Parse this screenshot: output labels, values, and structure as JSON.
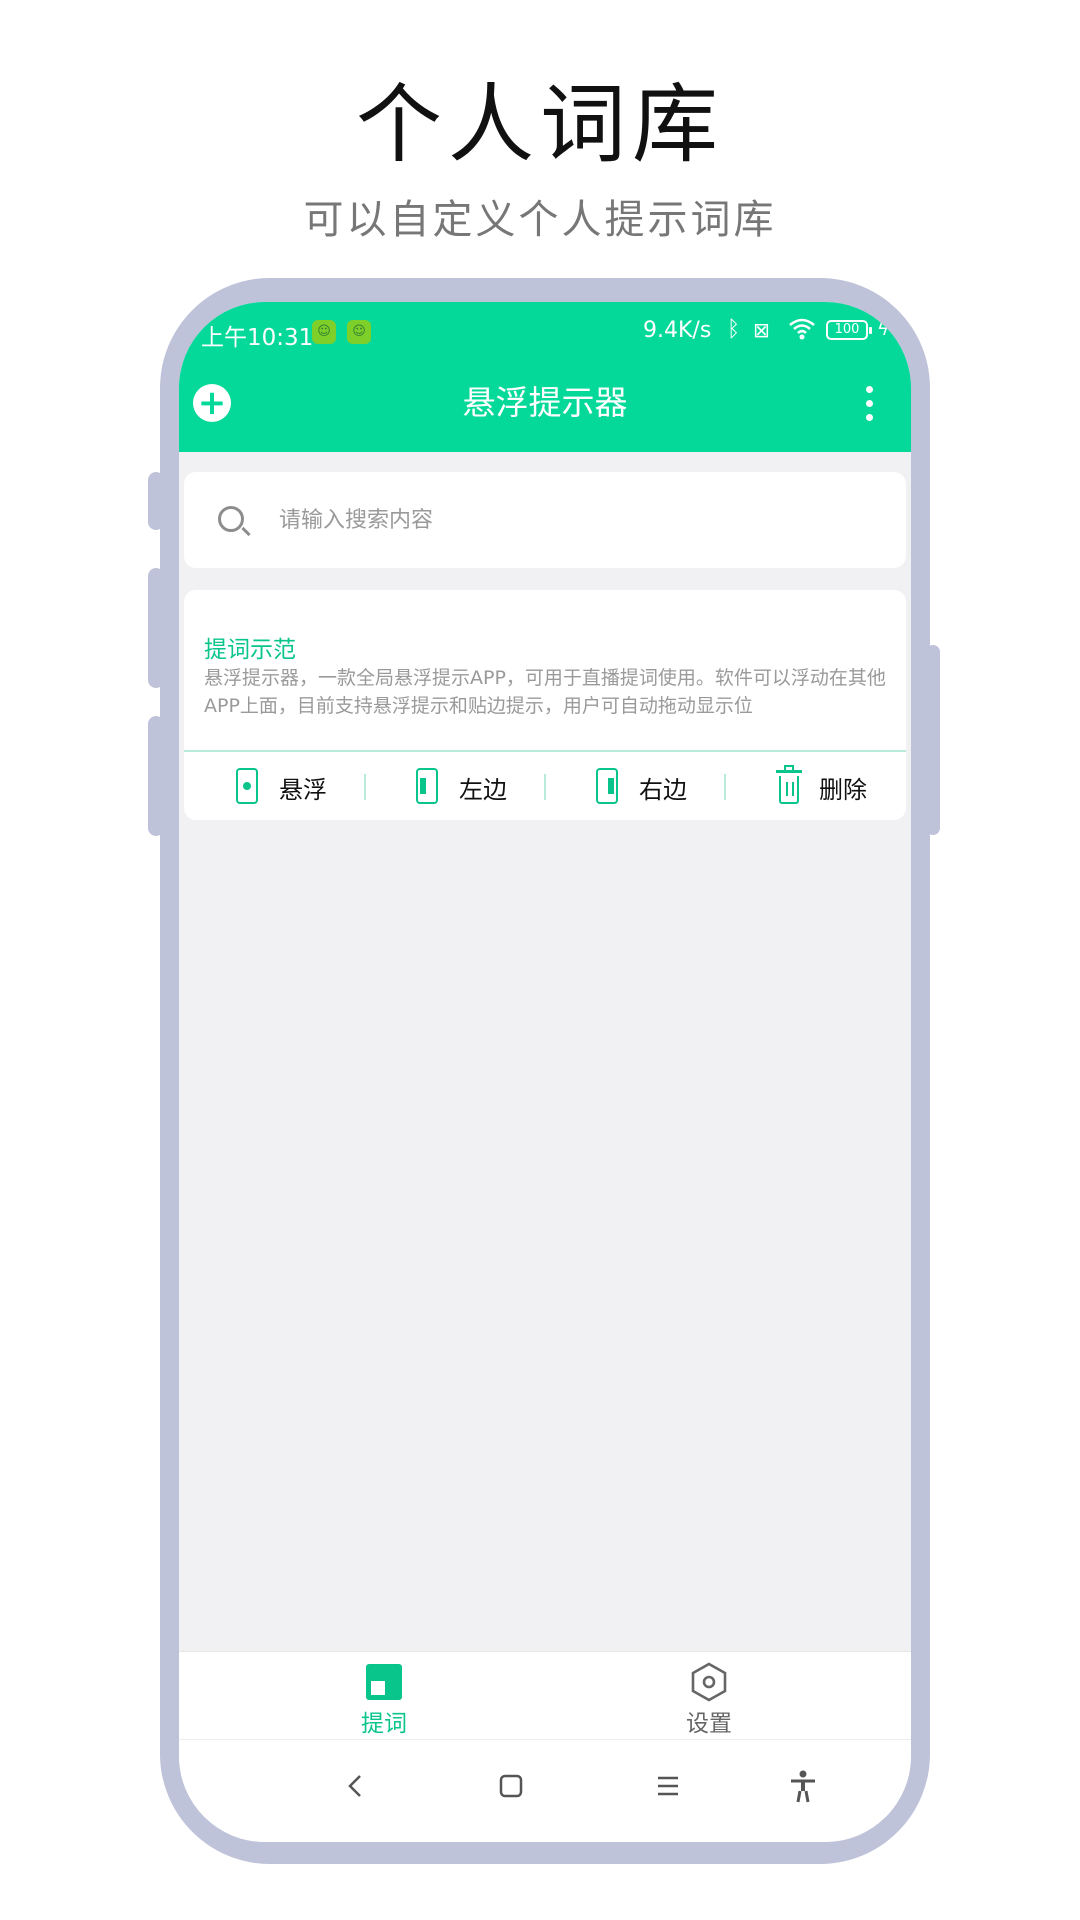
{
  "promo": {
    "title": "个人词库",
    "subtitle": "可以自定义个人提示词库"
  },
  "status_bar": {
    "time": "上午10:31",
    "network_speed": "9.4K/s",
    "battery": "100"
  },
  "header": {
    "title": "悬浮提示器",
    "add_icon": "plus-circle-icon",
    "more_icon": "more-vertical-icon"
  },
  "search": {
    "placeholder": "请输入搜索内容",
    "value": "",
    "icon": "search-icon"
  },
  "card": {
    "title": "提词示范",
    "description": "悬浮提示器，一款全局悬浮提示APP，可用于直播提词使用。软件可以浮动在其他APP上面，目前支持悬浮提示和贴边提示，用户可自动拖动显示位",
    "actions": [
      {
        "label": "悬浮",
        "icon": "float-window-icon"
      },
      {
        "label": "左边",
        "icon": "dock-left-icon"
      },
      {
        "label": "右边",
        "icon": "dock-right-icon"
      },
      {
        "label": "删除",
        "icon": "trash-icon"
      }
    ]
  },
  "bottom_nav": {
    "items": [
      {
        "label": "提词",
        "icon": "prompt-icon",
        "active": true
      },
      {
        "label": "设置",
        "icon": "settings-icon",
        "active": false
      }
    ]
  },
  "colors": {
    "accent": "#05d99a",
    "accent_text": "#09c58c",
    "frame": "#bec3d9",
    "background": "#f1f1f3"
  }
}
